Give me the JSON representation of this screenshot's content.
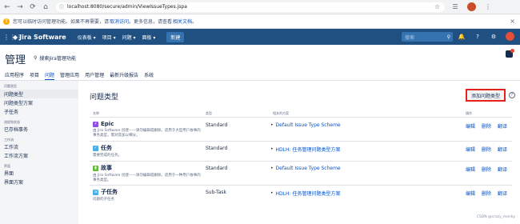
{
  "browser": {
    "back": "←",
    "forward": "→",
    "reload": "⟳",
    "home": "⌂",
    "url": "localhost:8080/secure/admin/ViewIssueTypes.jspa",
    "lock": "ⓘ",
    "star": "☆",
    "ext_icon": "☰",
    "menu_icon": "⋮"
  },
  "warning": {
    "icon": "!",
    "text": "您可以临时访问管理功能。如果不再需要，请",
    "link1": "取消访问",
    "mid": "。更多信息，请查看",
    "link2": "相关文档",
    "end": "。",
    "close": "×"
  },
  "header": {
    "grid": "⋮⋮⋮",
    "logo_mark": "◆",
    "logo_text": "Jira Software",
    "nav": [
      "仪表板 ▾",
      "项目 ▾",
      "问题 ▾",
      "面板 ▾"
    ],
    "create": "新建",
    "search_placeholder": "搜索",
    "search_icon": "⚲",
    "bell": "🔔",
    "help": "?",
    "gear": "⚙"
  },
  "admin": {
    "title": "管理",
    "search_icon": "⚲",
    "search_label": "搜索Jira管理功能",
    "tabs": [
      "应用程序",
      "项目",
      "问题",
      "管理应用",
      "用户管理",
      "最新升级报告",
      "系统"
    ],
    "active_tab": "问题"
  },
  "sidebar": {
    "sections": [
      {
        "title": "问题类型",
        "items": [
          "问题类型",
          "问题类型方案",
          "子任务"
        ]
      },
      {
        "title": "流程和状态",
        "items": [
          "已存档事务"
        ]
      },
      {
        "title": "工作流",
        "items": [
          "工作流",
          "工作流方案"
        ]
      },
      {
        "title": "界面",
        "items": [
          "界面",
          "界面方案"
        ]
      }
    ],
    "active_item": "问题类型"
  },
  "main": {
    "title": "问题类型",
    "add_button": "添加问题类型",
    "help_icon": "?",
    "columns": [
      "名称",
      "类型",
      "相关的方案",
      "操作"
    ],
    "rows": [
      {
        "icon": "⚡",
        "icon_color": "#904ee2",
        "name": "Epic",
        "desc": "由 Jira Software 创建——请勿编辑或删除。适用于大型用户故事的事务类型，需对其加以细分。",
        "type": "Standard",
        "scheme": "Default Issue Type Scheme",
        "ops": [
          "编辑",
          "删除",
          "翻译"
        ]
      },
      {
        "icon": "✓",
        "icon_color": "#4bade8",
        "name": "任务",
        "desc": "需要完成的任务。",
        "type": "Standard",
        "scheme": "HDLH: 任务管理问题类型方案",
        "ops": [
          "编辑",
          "删除",
          "翻译"
        ]
      },
      {
        "icon": "▮",
        "icon_color": "#63ba3c",
        "name": "故事",
        "desc": "由 Jira Software 创建——请勿编辑或删除。适用于一种用户故事的事务类型。",
        "type": "Standard",
        "scheme": "Default Issue Type Scheme",
        "ops": [
          "编辑",
          "删除",
          "翻译"
        ]
      },
      {
        "icon": "⇲",
        "icon_color": "#4bade8",
        "name": "子任务",
        "desc": "问题的子任务",
        "type": "Sub-Task",
        "scheme": "HDLH: 任务管理问题类型方案",
        "ops": [
          "编辑",
          "删除",
          "翻译"
        ]
      }
    ]
  },
  "watermark": "CSDN @crazy_monky"
}
